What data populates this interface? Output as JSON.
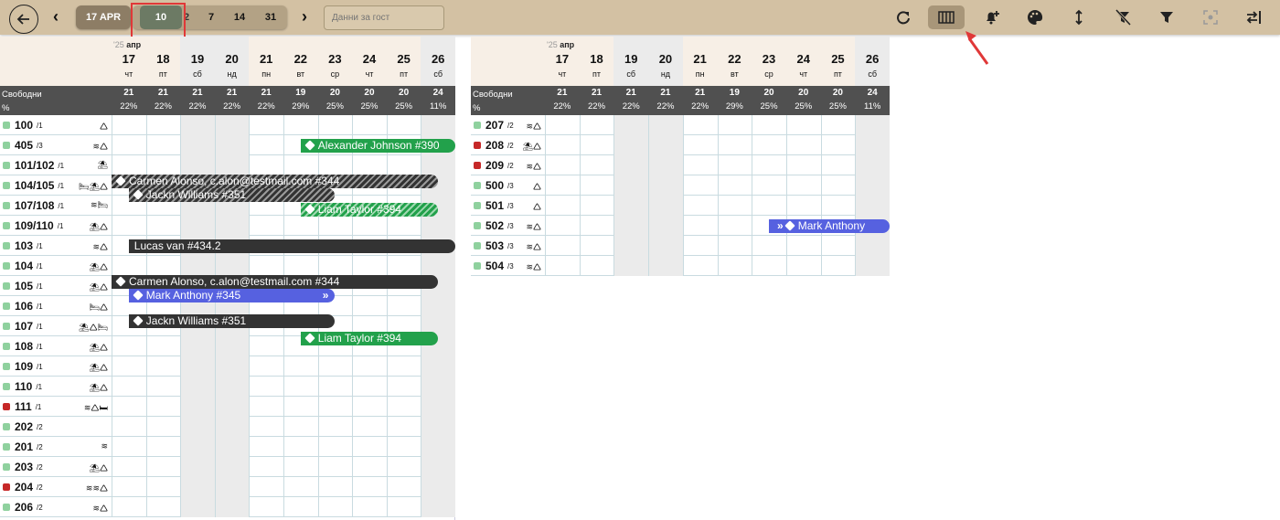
{
  "toolbar": {
    "back_icon": "arrow-left-icon",
    "prev_icon": "chevron-left-icon",
    "next_icon": "chevron-right-icon",
    "date_label": "17 APR",
    "ranges": [
      "10",
      "2",
      "7",
      "14",
      "31"
    ],
    "active_range": "10",
    "guest_placeholder": "Данни за гост",
    "icons": [
      "refresh-icon",
      "columns-icon",
      "bell-plus-icon",
      "palette-icon",
      "vertical-resize-icon",
      "filter-off-icon",
      "filter-icon",
      "focus-icon",
      "swap-icon"
    ]
  },
  "calendar": {
    "year": "'25",
    "month": "апр",
    "days": [
      {
        "d": "17",
        "w": "чт",
        "free": "21",
        "pct": "22%"
      },
      {
        "d": "18",
        "w": "пт",
        "free": "21",
        "pct": "22%"
      },
      {
        "d": "19",
        "w": "сб",
        "free": "21",
        "pct": "22%",
        "wk": true
      },
      {
        "d": "20",
        "w": "нд",
        "free": "21",
        "pct": "22%",
        "wk": true
      },
      {
        "d": "21",
        "w": "пн",
        "free": "21",
        "pct": "22%"
      },
      {
        "d": "22",
        "w": "вт",
        "free": "19",
        "pct": "29%"
      },
      {
        "d": "23",
        "w": "ср",
        "free": "20",
        "pct": "25%"
      },
      {
        "d": "24",
        "w": "чт",
        "free": "20",
        "pct": "25%"
      },
      {
        "d": "25",
        "w": "пт",
        "free": "20",
        "pct": "25%"
      },
      {
        "d": "26",
        "w": "сб",
        "free": "24",
        "pct": "11%",
        "wk": true
      }
    ],
    "avail_label": "Свободни",
    "avail_pct_label": "%"
  },
  "left_rooms": [
    {
      "name": "100",
      "cap": "/1",
      "status": "green",
      "icons": "🛆"
    },
    {
      "name": "405",
      "cap": "/3",
      "status": "green",
      "icons": "≋🛆"
    },
    {
      "name": "101/102",
      "cap": "/1",
      "status": "green",
      "icons": "⛱"
    },
    {
      "name": "104/105",
      "cap": "/1",
      "status": "green",
      "icons": "🛏⛱🛆"
    },
    {
      "name": "107/108",
      "cap": "/1",
      "status": "green",
      "icons": "≋🛏"
    },
    {
      "name": "109/110",
      "cap": "/1",
      "status": "green",
      "icons": "⛱🛆"
    },
    {
      "name": "103",
      "cap": "/1",
      "status": "green",
      "icons": "≋🛆"
    },
    {
      "name": "104",
      "cap": "/1",
      "status": "green",
      "icons": "⛱🛆"
    },
    {
      "name": "105",
      "cap": "/1",
      "status": "green",
      "icons": "⛱🛆"
    },
    {
      "name": "106",
      "cap": "/1",
      "status": "green",
      "icons": "🛏🛆"
    },
    {
      "name": "107",
      "cap": "/1",
      "status": "green",
      "icons": "⛱🛆🛏"
    },
    {
      "name": "108",
      "cap": "/1",
      "status": "green",
      "icons": "⛱🛆"
    },
    {
      "name": "109",
      "cap": "/1",
      "status": "green",
      "icons": "⛱🛆"
    },
    {
      "name": "110",
      "cap": "/1",
      "status": "green",
      "icons": "⛱🛆"
    },
    {
      "name": "111",
      "cap": "/1",
      "status": "red",
      "icons": "≋🛆🛏"
    },
    {
      "name": "202",
      "cap": "/2",
      "status": "green",
      "icons": ""
    },
    {
      "name": "201",
      "cap": "/2",
      "status": "green",
      "icons": "≋"
    },
    {
      "name": "203",
      "cap": "/2",
      "status": "green",
      "icons": "⛱🛆"
    },
    {
      "name": "204",
      "cap": "/2",
      "status": "red",
      "icons": "≋≋🛆"
    },
    {
      "name": "206",
      "cap": "/2",
      "status": "green",
      "icons": "≋🛆"
    }
  ],
  "right_rooms": [
    {
      "name": "207",
      "cap": "/2",
      "status": "green",
      "icons": "≋🛆"
    },
    {
      "name": "208",
      "cap": "/2",
      "status": "red",
      "icons": "⛱🛆"
    },
    {
      "name": "209",
      "cap": "/2",
      "status": "red",
      "icons": "≋🛆"
    },
    {
      "name": "500",
      "cap": "/3",
      "status": "green",
      "icons": "🛆"
    },
    {
      "name": "501",
      "cap": "/3",
      "status": "green",
      "icons": "🛆"
    },
    {
      "name": "502",
      "cap": "/3",
      "status": "green",
      "icons": "≋🛆"
    },
    {
      "name": "503",
      "cap": "/3",
      "status": "green",
      "icons": "≋🛆"
    },
    {
      "name": "504",
      "cap": "/3",
      "status": "green",
      "icons": "≋🛆"
    }
  ],
  "left_bookings": [
    {
      "row": 1,
      "start": 5.5,
      "end": 10,
      "style": "green",
      "label": "Alexander Johnson #390"
    },
    {
      "row": 3,
      "start": 0,
      "end": 9.5,
      "style": "hatch-dark",
      "label": "Carmen Alonso, c.alon@testmail.com #344",
      "yoff": -5
    },
    {
      "row": 3,
      "start": 0.5,
      "end": 6.5,
      "style": "hatch-dark",
      "label": "Jackn Williams #351",
      "yoff": 10
    },
    {
      "row": 4,
      "start": 5.5,
      "end": 9.5,
      "style": "hatch-green",
      "label": "Liam Taylor #394",
      "yoff": 4
    },
    {
      "row": 6,
      "start": 0.5,
      "end": 10,
      "style": "dark",
      "label": "Lucas van #434.2",
      "notag": true
    },
    {
      "row": 8,
      "start": 0,
      "end": 9.5,
      "style": "dark",
      "label": "Carmen Alonso, c.alon@testmail.com #344",
      "yoff": -5
    },
    {
      "row": 8,
      "start": 0.5,
      "end": 6.5,
      "style": "blue",
      "label": "Mark Anthony #345",
      "yoff": 10,
      "chev_end": true
    },
    {
      "row": 10,
      "start": 0.5,
      "end": 6.5,
      "style": "dark",
      "label": "Jackn Williams #351",
      "yoff": -6
    },
    {
      "row": 10,
      "start": 5.5,
      "end": 9.5,
      "style": "green",
      "label": "Liam Taylor #394",
      "yoff": 13
    }
  ],
  "right_bookings": [
    {
      "row": 5,
      "start": 6.5,
      "end": 10,
      "style": "blue",
      "label": "Mark Anthony",
      "chev_start": true
    }
  ]
}
